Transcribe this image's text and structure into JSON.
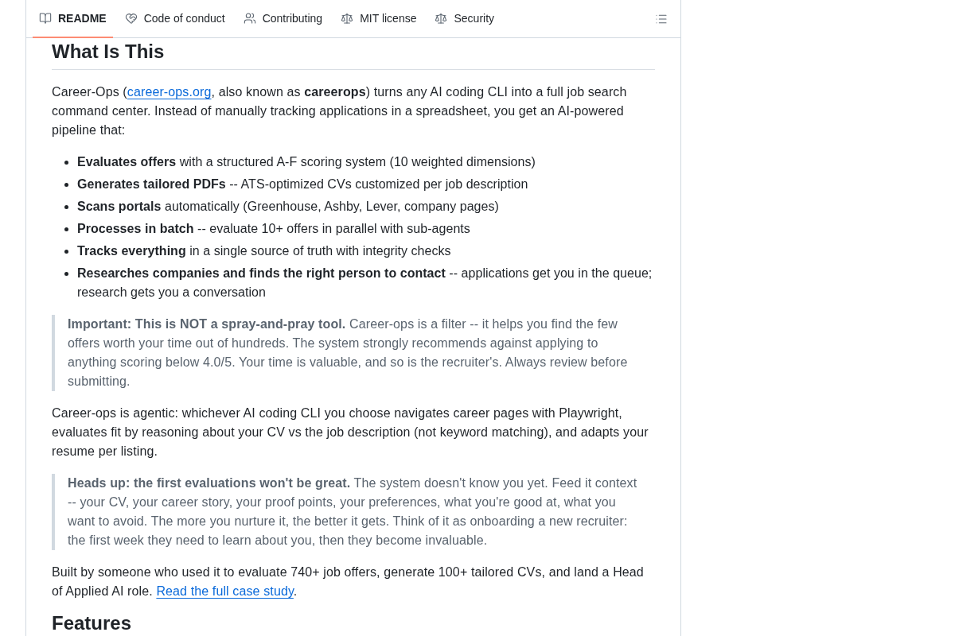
{
  "readme_tabs": [
    {
      "kind": "readme",
      "label": "README",
      "selected": true
    },
    {
      "kind": "conduct",
      "label": "Code of conduct",
      "selected": false
    },
    {
      "kind": "contributing",
      "label": "Contributing",
      "selected": false
    },
    {
      "kind": "license",
      "label": "MIT license",
      "selected": false
    },
    {
      "kind": "security",
      "label": "Security",
      "selected": false
    }
  ],
  "article": {
    "blocks": [
      {
        "kind": "heading",
        "text": "What Is This"
      },
      {
        "kind": "paragraph",
        "parts": [
          {
            "kind": "text",
            "text": "Career-Ops ("
          },
          {
            "kind": "link",
            "text": "career-ops.org"
          },
          {
            "kind": "text",
            "text": ", also known as **careerops**) turns any AI coding CLI into a full job search command center. Instead of manually tracking applications in a spreadsheet, you get an AI-powered pipeline that:"
          }
        ]
      },
      {
        "kind": "list",
        "items": [
          "**Evaluates offers** with a structured A-F scoring system (10 weighted dimensions)",
          "**Generates tailored PDFs** -- ATS-optimized CVs customized per job description",
          "**Scans portals** automatically (Greenhouse, Ashby, Lever, company pages)",
          "**Processes in batch** -- evaluate 10+ offers in parallel with sub-agents",
          "**Tracks everything** in a single source of truth with integrity checks",
          "**Researches companies and finds the right person to contact** -- applications get you in the queue; research gets you a conversation"
        ]
      },
      {
        "kind": "quote",
        "text": "**Important: This is NOT a spray-and-pray tool.** Career-ops is a filter -- it helps you find the few offers worth your time out of hundreds. The system strongly recommends against applying to anything scoring below 4.0/5. Your time is valuable, and so is the recruiter's. Always review before submitting."
      },
      {
        "kind": "paragraph",
        "parts": [
          {
            "kind": "text",
            "text": "Career-ops is agentic: whichever AI coding CLI you choose navigates career pages with Playwright, evaluates fit by reasoning about your CV vs the job description (not keyword matching), and adapts your resume per listing."
          }
        ]
      },
      {
        "kind": "quote",
        "text": "**Heads up: the first evaluations won't be great.** The system doesn't know you yet. Feed it context -- your CV, your career story, your proof points, your preferences, what you're good at, what you want to avoid. The more you nurture it, the better it gets. Think of it as onboarding a new recruiter: the first week they need to learn about you, then they become invaluable."
      },
      {
        "kind": "paragraph",
        "parts": [
          {
            "kind": "text",
            "text": "Built by someone who used it to evaluate 740+ job offers, generate 100+ tailored CVs, and land a Head of Applied AI role. "
          },
          {
            "kind": "link",
            "text": "Read the full case study"
          },
          {
            "kind": "text",
            "text": "."
          }
        ]
      },
      {
        "kind": "heading",
        "text": "Features"
      }
    ]
  }
}
